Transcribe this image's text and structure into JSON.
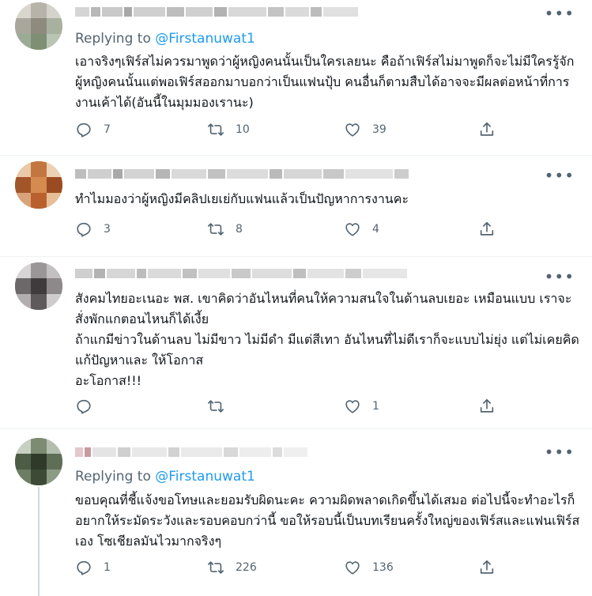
{
  "more_glyph": "•••",
  "colors": {
    "link": "#1d9bf0",
    "secondary": "#536471",
    "text": "#0f1419"
  },
  "tweets": [
    {
      "replying_prefix": "Replying to",
      "replying_handle": "@Firstanuwat1",
      "text": "เอาจริงๆเฟิร์สไม่ควรมาพูดว่าผู้หญิงคนนั้นเป็นใครเลยนะ คือถ้าเฟิร์สไม่มาพูดก็จะไม่มีใครรู้จักผู้หญิงคนนั้นแต่พอเฟิร์สออกมาบอกว่าเป็นแฟนปุ้บ คนอื่นก็ตามสืบได้อาจจะมีผลต่อหน้าที่การงานเค้าได้(อันนี้ในมุมมองเรานะ)",
      "replies": "7",
      "retweets": "10",
      "likes": "39"
    },
    {
      "text": "ทำไมมองว่าผู้หญิงมีคลิปเยเย่กับแฟนแล้วเป็นปัญหาการงานคะ",
      "replies": "3",
      "retweets": "8",
      "likes": "4"
    },
    {
      "text": "สังคมไทยอะเนอะ พส. เขาคิดว่าอันไหนที่คนให้ความสนใจในด้านลบเยอะ เหมือนแบบ เราจะสั่งพักแกตอนไหนก็ได้เงี้ย\nถ้าแกมีข่าวในด้านลบ ไม่มีขาว ไม่มีดำ มีแต่สีเทา อันไหนที่ไม่ดีเราก็จะแบบไม่ยุ่ง แต่ไม่เคยคิดแก้ปัญหาและ ให้โอกาส\nอะโอกาส!!!",
      "replies": "",
      "retweets": "",
      "likes": "1"
    },
    {
      "replying_prefix": "Replying to",
      "replying_handle": "@Firstanuwat1",
      "text": "ขอบคุณที่ชี้แจ้งขอโทษและยอมรับผิดนะคะ ความผิดพลาดเกิดขึ้นได้เสมอ ต่อไปนี้จะทำอะไรก็อยากให้ระมัดระวังและรอบคอบกว่านี้ ขอให้รอบนี้เป็นบทเรียนครั้งใหญ่ของเฟิร์สและแฟนเฟิร์สเอง โซเชียลมันไวมากจริงๆ",
      "replies": "1",
      "retweets": "226",
      "likes": "136"
    }
  ]
}
